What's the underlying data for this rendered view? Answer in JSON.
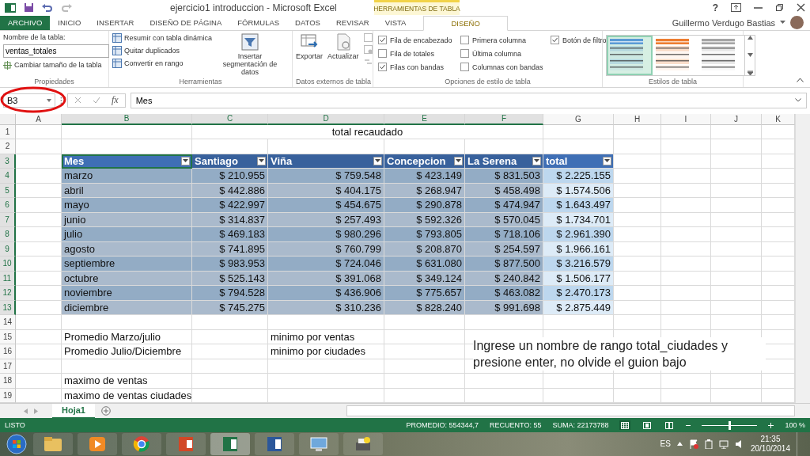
{
  "window": {
    "title": "ejercicio1 introduccion - Microsoft Excel",
    "help": "?",
    "user": "Guillermo Verdugo Bastias",
    "context_label": "HERRAMIENTAS DE TABLA"
  },
  "tabs": [
    {
      "label": "ARCHIVO",
      "kind": "file",
      "selected": false
    },
    {
      "label": "INICIO",
      "kind": "normal",
      "selected": false
    },
    {
      "label": "INSERTAR",
      "kind": "normal",
      "selected": false
    },
    {
      "label": "DISEÑO DE PÁGINA",
      "kind": "normal",
      "selected": false
    },
    {
      "label": "FÓRMULAS",
      "kind": "normal",
      "selected": false
    },
    {
      "label": "DATOS",
      "kind": "normal",
      "selected": false
    },
    {
      "label": "REVISAR",
      "kind": "normal",
      "selected": false
    },
    {
      "label": "VISTA",
      "kind": "normal",
      "selected": false
    },
    {
      "label": "DISEÑO",
      "kind": "contextual",
      "selected": true
    }
  ],
  "ribbon": {
    "properties": {
      "name_label": "Nombre de la tabla:",
      "name_value": "ventas_totales",
      "resize": "Cambiar tamaño de la tabla",
      "group": "Propiedades"
    },
    "tools": {
      "items": [
        "Resumir con tabla dinámica",
        "Quitar duplicados",
        "Convertir en rango"
      ],
      "slicer": "Insertar segmentación de datos",
      "group": "Herramientas"
    },
    "external": {
      "export": "Exportar",
      "refresh": "Actualizar",
      "group": "Datos externos de tabla"
    },
    "style_options": [
      {
        "label": "Fila de encabezado",
        "checked": true
      },
      {
        "label": "Fila de totales",
        "checked": false
      },
      {
        "label": "Filas con bandas",
        "checked": true
      },
      {
        "label": "Primera columna",
        "checked": false
      },
      {
        "label": "Última columna",
        "checked": false
      },
      {
        "label": "Columnas con bandas",
        "checked": false
      },
      {
        "label": "Botón de filtro",
        "checked": true
      }
    ],
    "style_options_group": "Opciones de estilo de tabla",
    "table_styles": [
      {
        "color": "#5b9bd5",
        "selected": true
      },
      {
        "color": "#ed7d31",
        "selected": false
      },
      {
        "color": "#a5a5a5",
        "selected": false
      }
    ],
    "table_styles_group": "Estilos de tabla"
  },
  "formula_bar": {
    "name_box": "B3",
    "fx": "fx",
    "value": "Mes"
  },
  "columns": [
    {
      "label": "A",
      "selected": false
    },
    {
      "label": "B",
      "selected": true
    },
    {
      "label": "C",
      "selected": true
    },
    {
      "label": "D",
      "selected": true
    },
    {
      "label": "E",
      "selected": true
    },
    {
      "label": "F",
      "selected": true
    },
    {
      "label": "G",
      "selected": false
    },
    {
      "label": "H",
      "selected": false
    },
    {
      "label": "I",
      "selected": false
    },
    {
      "label": "J",
      "selected": false
    },
    {
      "label": "K",
      "selected": false
    }
  ],
  "rows": [
    {
      "number": "1",
      "selected": false,
      "cells": [
        {},
        {},
        {
          "text": "total recaudado",
          "kind": "title"
        }
      ]
    },
    {
      "number": "2",
      "selected": false
    },
    {
      "number": "3",
      "selected": true,
      "kind": "table-header",
      "cells": [
        {},
        {
          "text": "Mes",
          "kind": "header",
          "active": true
        },
        {
          "text": "Santiago",
          "kind": "header"
        },
        {
          "text": "Viña",
          "kind": "header"
        },
        {
          "text": "Concepcion",
          "kind": "header"
        },
        {
          "text": "La Serena",
          "kind": "header"
        },
        {
          "text": "total",
          "kind": "header"
        }
      ]
    },
    {
      "number": "4",
      "selected": true,
      "kind": "table-row",
      "cells": [
        {},
        {
          "text": "marzo",
          "kind": "text"
        },
        {
          "text": "$ 210.955",
          "kind": "number"
        },
        {
          "text": "$ 759.548",
          "kind": "number"
        },
        {
          "text": "$ 423.149",
          "kind": "number"
        },
        {
          "text": "$ 831.503",
          "kind": "number"
        },
        {
          "text": "$ 2.225.155",
          "kind": "number"
        }
      ]
    },
    {
      "number": "5",
      "selected": true,
      "kind": "table-row",
      "cells": [
        {},
        {
          "text": "abril",
          "kind": "text"
        },
        {
          "text": "$ 442.886",
          "kind": "number"
        },
        {
          "text": "$ 404.175",
          "kind": "number"
        },
        {
          "text": "$ 268.947",
          "kind": "number"
        },
        {
          "text": "$ 458.498",
          "kind": "number"
        },
        {
          "text": "$ 1.574.506",
          "kind": "number"
        }
      ]
    },
    {
      "number": "6",
      "selected": true,
      "kind": "table-row",
      "cells": [
        {},
        {
          "text": "mayo",
          "kind": "text"
        },
        {
          "text": "$ 422.997",
          "kind": "number"
        },
        {
          "text": "$ 454.675",
          "kind": "number"
        },
        {
          "text": "$ 290.878",
          "kind": "number"
        },
        {
          "text": "$ 474.947",
          "kind": "number"
        },
        {
          "text": "$ 1.643.497",
          "kind": "number"
        }
      ]
    },
    {
      "number": "7",
      "selected": true,
      "kind": "table-row",
      "cells": [
        {},
        {
          "text": "junio",
          "kind": "text"
        },
        {
          "text": "$ 314.837",
          "kind": "number"
        },
        {
          "text": "$ 257.493",
          "kind": "number"
        },
        {
          "text": "$ 592.326",
          "kind": "number"
        },
        {
          "text": "$ 570.045",
          "kind": "number"
        },
        {
          "text": "$ 1.734.701",
          "kind": "number"
        }
      ]
    },
    {
      "number": "8",
      "selected": true,
      "kind": "table-row",
      "cells": [
        {},
        {
          "text": "julio",
          "kind": "text"
        },
        {
          "text": "$ 469.183",
          "kind": "number"
        },
        {
          "text": "$ 980.296",
          "kind": "number"
        },
        {
          "text": "$ 793.805",
          "kind": "number"
        },
        {
          "text": "$ 718.106",
          "kind": "number"
        },
        {
          "text": "$ 2.961.390",
          "kind": "number"
        }
      ]
    },
    {
      "number": "9",
      "selected": true,
      "kind": "table-row",
      "cells": [
        {},
        {
          "text": "agosto",
          "kind": "text"
        },
        {
          "text": "$ 741.895",
          "kind": "number"
        },
        {
          "text": "$ 760.799",
          "kind": "number"
        },
        {
          "text": "$ 208.870",
          "kind": "number"
        },
        {
          "text": "$ 254.597",
          "kind": "number"
        },
        {
          "text": "$ 1.966.161",
          "kind": "number"
        }
      ]
    },
    {
      "number": "10",
      "selected": true,
      "kind": "table-row",
      "cells": [
        {},
        {
          "text": "septiembre",
          "kind": "text"
        },
        {
          "text": "$ 983.953",
          "kind": "number"
        },
        {
          "text": "$ 724.046",
          "kind": "number"
        },
        {
          "text": "$ 631.080",
          "kind": "number"
        },
        {
          "text": "$ 877.500",
          "kind": "number"
        },
        {
          "text": "$ 3.216.579",
          "kind": "number"
        }
      ]
    },
    {
      "number": "11",
      "selected": true,
      "kind": "table-row",
      "cells": [
        {},
        {
          "text": "octubre",
          "kind": "text"
        },
        {
          "text": "$ 525.143",
          "kind": "number"
        },
        {
          "text": "$ 391.068",
          "kind": "number"
        },
        {
          "text": "$ 349.124",
          "kind": "number"
        },
        {
          "text": "$ 240.842",
          "kind": "number"
        },
        {
          "text": "$ 1.506.177",
          "kind": "number"
        }
      ]
    },
    {
      "number": "12",
      "selected": true,
      "kind": "table-row",
      "cells": [
        {},
        {
          "text": "noviembre",
          "kind": "text"
        },
        {
          "text": "$ 794.528",
          "kind": "number"
        },
        {
          "text": "$ 436.906",
          "kind": "number"
        },
        {
          "text": "$ 775.657",
          "kind": "number"
        },
        {
          "text": "$ 463.082",
          "kind": "number"
        },
        {
          "text": "$ 2.470.173",
          "kind": "number"
        }
      ]
    },
    {
      "number": "13",
      "selected": true,
      "kind": "table-row",
      "cells": [
        {},
        {
          "text": "diciembre",
          "kind": "text"
        },
        {
          "text": "$ 745.275",
          "kind": "number"
        },
        {
          "text": "$ 310.236",
          "kind": "number"
        },
        {
          "text": "$ 828.240",
          "kind": "number"
        },
        {
          "text": "$ 991.698",
          "kind": "number"
        },
        {
          "text": "$ 2.875.449",
          "kind": "number"
        }
      ]
    },
    {
      "number": "14",
      "selected": false
    },
    {
      "number": "15",
      "selected": false,
      "cells": [
        {},
        {
          "text": "Promedio Marzo/julio",
          "kind": "text"
        },
        {},
        {
          "text": "minimo por ventas",
          "kind": "text"
        }
      ]
    },
    {
      "number": "16",
      "selected": false,
      "cells": [
        {},
        {
          "text": "Promedio Julio/Diciembre",
          "kind": "text"
        },
        {},
        {
          "text": "minimo por ciudades",
          "kind": "text"
        }
      ]
    },
    {
      "number": "17",
      "selected": false
    },
    {
      "number": "18",
      "selected": false,
      "cells": [
        {},
        {
          "text": "maximo de ventas",
          "kind": "text"
        }
      ]
    },
    {
      "number": "19",
      "selected": false,
      "cells": [
        {},
        {
          "text": "maximo de ventas ciudades",
          "kind": "text"
        }
      ]
    }
  ],
  "note": "Ingrese un nombre de rango total_ciudades y presione enter, no olvide el guion bajo",
  "sheet_tabs": [
    {
      "label": "Hoja1",
      "selected": true
    }
  ],
  "status_bar": {
    "state": "LISTO",
    "average": "PROMEDIO: 554344,7",
    "count": "RECUENTO: 55",
    "sum": "SUMA: 22173788",
    "views": [
      {
        "kind": "normal",
        "selected": true
      },
      {
        "kind": "layout",
        "selected": false
      },
      {
        "kind": "pagebreak",
        "selected": false
      }
    ],
    "zoom": {
      "level": 0.5
    },
    "zoom_text": "100 %"
  },
  "taskbar": {
    "apps": [
      {
        "kind": "folder",
        "active": false
      },
      {
        "kind": "media",
        "active": false
      },
      {
        "kind": "browser",
        "active": false
      },
      {
        "kind": "slides",
        "active": false
      },
      {
        "kind": "sheet",
        "active": true
      },
      {
        "kind": "doc",
        "active": false
      },
      {
        "kind": "network",
        "active": false
      },
      {
        "kind": "printer",
        "active": false
      }
    ],
    "language": "ES",
    "time": "21:35",
    "date": "20/10/2014"
  }
}
